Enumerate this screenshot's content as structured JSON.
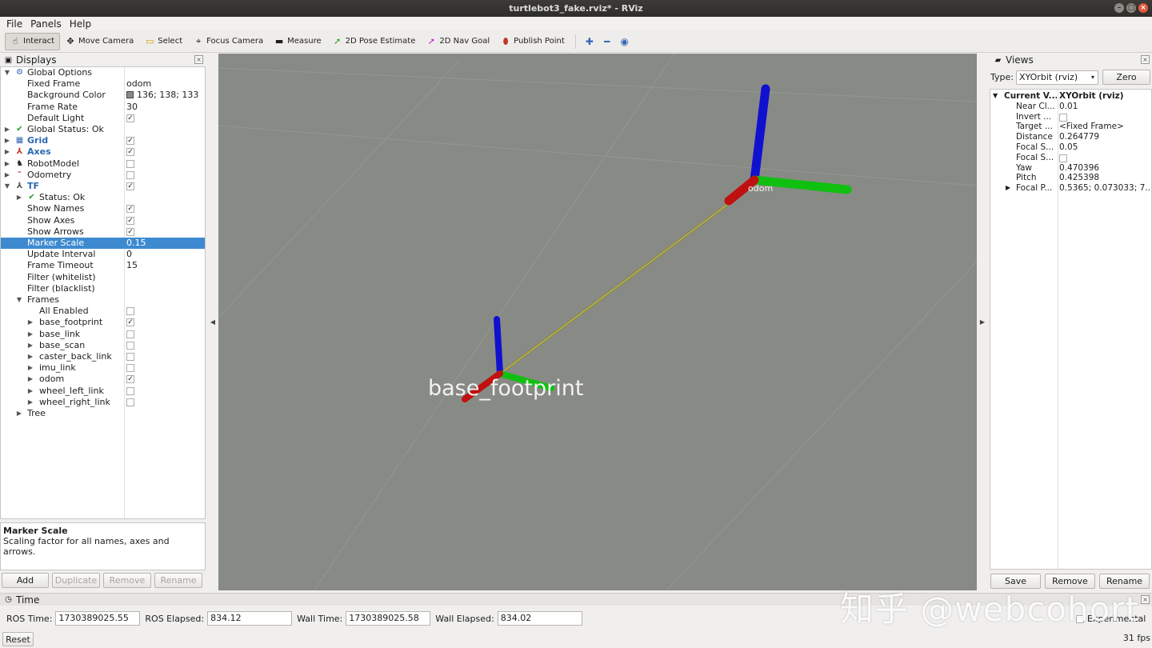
{
  "window": {
    "title": "turtlebot3_fake.rviz* - RViz"
  },
  "menu": [
    "File",
    "Panels",
    "Help"
  ],
  "toolbar": {
    "tools": [
      {
        "label": "Interact",
        "icon": "hand-icon",
        "active": true
      },
      {
        "label": "Move Camera",
        "icon": "move-camera-icon"
      },
      {
        "label": "Select",
        "icon": "select-icon"
      },
      {
        "label": "Focus Camera",
        "icon": "focus-camera-icon"
      },
      {
        "label": "Measure",
        "icon": "ruler-icon"
      },
      {
        "label": "2D Pose Estimate",
        "icon": "pose-arrow-icon"
      },
      {
        "label": "2D Nav Goal",
        "icon": "nav-goal-arrow-icon"
      },
      {
        "label": "Publish Point",
        "icon": "map-pin-icon"
      }
    ]
  },
  "displays": {
    "title": "Displays",
    "rows": [
      {
        "label": "Global Options",
        "value": ""
      },
      {
        "label": "Fixed Frame",
        "value": "odom"
      },
      {
        "label": "Background Color",
        "value": "136; 138; 133"
      },
      {
        "label": "Frame Rate",
        "value": "30"
      },
      {
        "label": "Default Light",
        "value": ""
      },
      {
        "label": "Global Status: Ok",
        "value": ""
      },
      {
        "label": "Grid",
        "value": ""
      },
      {
        "label": "Axes",
        "value": ""
      },
      {
        "label": "RobotModel",
        "value": ""
      },
      {
        "label": "Odometry",
        "value": ""
      },
      {
        "label": "TF",
        "value": ""
      },
      {
        "label": "Status: Ok",
        "value": ""
      },
      {
        "label": "Show Names",
        "value": ""
      },
      {
        "label": "Show Axes",
        "value": ""
      },
      {
        "label": "Show Arrows",
        "value": ""
      },
      {
        "label": "Marker Scale",
        "value": "0.15"
      },
      {
        "label": "Update Interval",
        "value": "0"
      },
      {
        "label": "Frame Timeout",
        "value": "15"
      },
      {
        "label": "Filter (whitelist)",
        "value": ""
      },
      {
        "label": "Filter (blacklist)",
        "value": ""
      },
      {
        "label": "Frames",
        "value": ""
      },
      {
        "label": "All Enabled",
        "value": ""
      },
      {
        "label": "base_footprint",
        "value": ""
      },
      {
        "label": "base_link",
        "value": ""
      },
      {
        "label": "base_scan",
        "value": ""
      },
      {
        "label": "caster_back_link",
        "value": ""
      },
      {
        "label": "imu_link",
        "value": ""
      },
      {
        "label": "odom",
        "value": ""
      },
      {
        "label": "wheel_left_link",
        "value": ""
      },
      {
        "label": "wheel_right_link",
        "value": ""
      },
      {
        "label": "Tree",
        "value": ""
      }
    ],
    "description": {
      "title": "Marker Scale",
      "text": "Scaling factor for all names, axes and arrows."
    },
    "buttons": [
      "Add",
      "Duplicate",
      "Remove",
      "Rename"
    ]
  },
  "viewport": {
    "background": "#888a85",
    "frame_labels": [
      "base_footprint",
      "odom"
    ]
  },
  "views": {
    "title": "Views",
    "type_label": "Type:",
    "type_value": "XYOrbit (rviz)",
    "zero_button": "Zero",
    "rows": [
      {
        "k": "Current V...",
        "v": "XYOrbit (rviz)"
      },
      {
        "k": "Near Cl...",
        "v": "0.01"
      },
      {
        "k": "Invert ...",
        "v": ""
      },
      {
        "k": "Target ...",
        "v": "<Fixed Frame>"
      },
      {
        "k": "Distance",
        "v": "0.264779"
      },
      {
        "k": "Focal S...",
        "v": "0.05"
      },
      {
        "k": "Focal S...",
        "v": ""
      },
      {
        "k": "Yaw",
        "v": "0.470396"
      },
      {
        "k": "Pitch",
        "v": "0.425398"
      },
      {
        "k": "Focal P...",
        "v": "0.5365; 0.073033; 7...."
      }
    ],
    "buttons": [
      "Save",
      "Remove",
      "Rename"
    ]
  },
  "time": {
    "title": "Time",
    "ros_time_label": "ROS Time:",
    "ros_time": "1730389025.55",
    "ros_elapsed_label": "ROS Elapsed:",
    "ros_elapsed": "834.12",
    "wall_time_label": "Wall Time:",
    "wall_time": "1730389025.58",
    "wall_elapsed_label": "Wall Elapsed:",
    "wall_elapsed": "834.02",
    "experimental": "Experimental",
    "reset": "Reset",
    "fps": "31 fps"
  },
  "watermark": "知乎 @webcohort"
}
